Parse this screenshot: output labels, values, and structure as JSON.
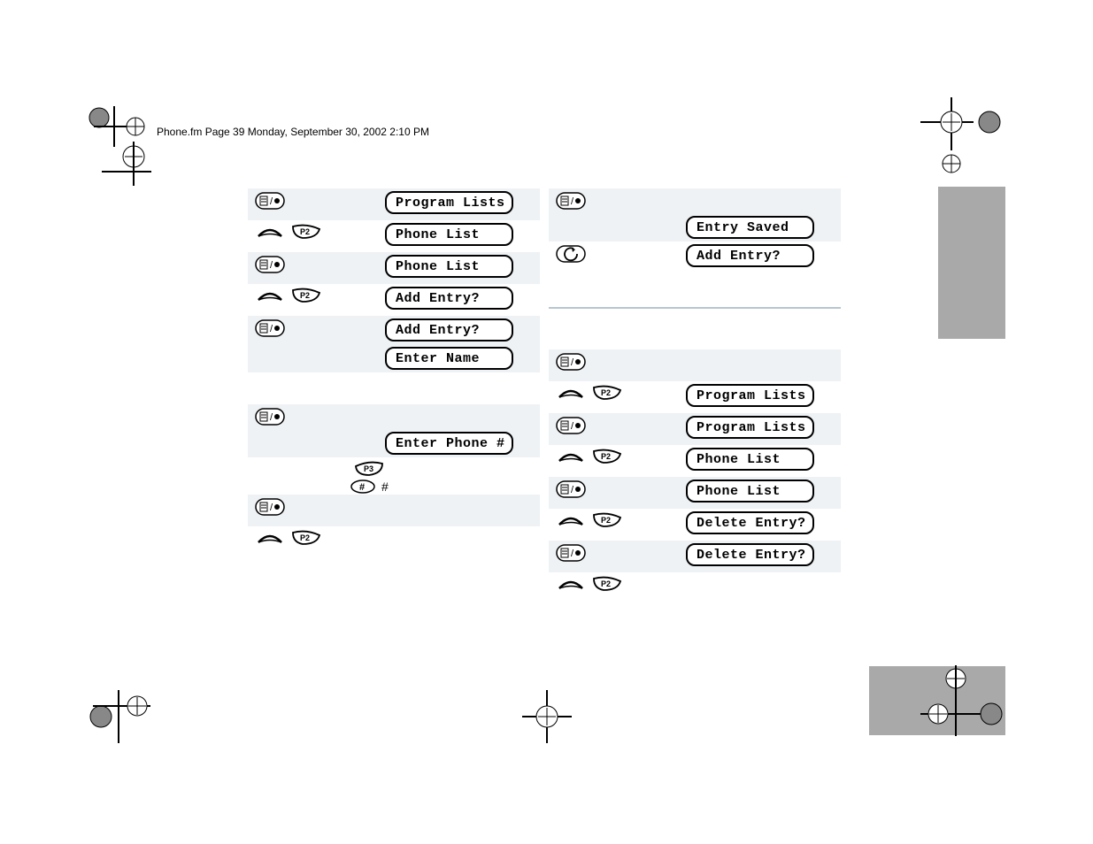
{
  "header": "Phone.fm  Page 39  Monday, September 30, 2002  2:10 PM",
  "left_steps": [
    {
      "icons": [
        "menu"
      ],
      "shade": true,
      "displays": [
        "Program Lists"
      ]
    },
    {
      "icons": [
        "rocker",
        "p2"
      ],
      "shade": false,
      "displays": [
        "Phone List"
      ]
    },
    {
      "icons": [
        "menu"
      ],
      "shade": true,
      "displays": [
        "Phone List"
      ]
    },
    {
      "icons": [
        "rocker",
        "p2"
      ],
      "shade": false,
      "displays": [
        "Add Entry?"
      ]
    },
    {
      "icons": [
        "menu"
      ],
      "shade": true,
      "displays": [
        "Add Entry?",
        "Enter Name"
      ]
    },
    {
      "icons": [],
      "shade": false,
      "displays": []
    },
    {
      "icons": [
        "menu"
      ],
      "shade": true,
      "displays": [
        "",
        "Enter Phone #"
      ]
    },
    {
      "icons": [
        "p3_hash"
      ],
      "shade": false,
      "displays": []
    },
    {
      "icons": [
        "menu"
      ],
      "shade": true,
      "displays": [
        ""
      ]
    },
    {
      "icons": [
        "rocker",
        "p2"
      ],
      "shade": false,
      "displays": []
    }
  ],
  "right_top_steps": [
    {
      "icons": [
        "menu"
      ],
      "shade": true,
      "displays": [
        "",
        "Entry Saved"
      ]
    },
    {
      "icons": [
        "back"
      ],
      "shade": false,
      "displays": [
        "Add Entry?"
      ]
    }
  ],
  "right_bottom_steps": [
    {
      "icons": [
        "menu"
      ],
      "shade": true,
      "displays": [
        ""
      ]
    },
    {
      "icons": [
        "rocker",
        "p2"
      ],
      "shade": false,
      "displays": [
        "Program Lists"
      ]
    },
    {
      "icons": [
        "menu"
      ],
      "shade": true,
      "displays": [
        "Program Lists"
      ]
    },
    {
      "icons": [
        "rocker",
        "p2"
      ],
      "shade": false,
      "displays": [
        "Phone List"
      ]
    },
    {
      "icons": [
        "menu"
      ],
      "shade": true,
      "displays": [
        "Phone List"
      ]
    },
    {
      "icons": [
        "rocker",
        "p2"
      ],
      "shade": false,
      "displays": [
        "Delete Entry?"
      ]
    },
    {
      "icons": [
        "menu"
      ],
      "shade": true,
      "displays": [
        "Delete Entry?"
      ]
    },
    {
      "icons": [
        "rocker",
        "p2"
      ],
      "shade": false,
      "displays": []
    }
  ],
  "hash_glyph": "#"
}
